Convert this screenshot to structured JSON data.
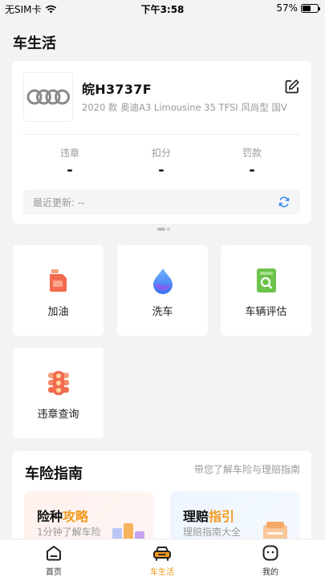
{
  "status_bar": {
    "carrier": "无SIM卡",
    "time": "下午3:58",
    "battery": "57%",
    "battery_level": 0.57
  },
  "page_title": "车生活",
  "car": {
    "plate": "皖H3737F",
    "model": "2020 款 奥迪A3 Limousine 35 TFSI 风尚型 国V",
    "logo_icon": "audi-rings-icon",
    "stats": [
      {
        "label": "违章",
        "value": "-"
      },
      {
        "label": "扣分",
        "value": "-"
      },
      {
        "label": "罚款",
        "value": "-"
      }
    ],
    "last_update": "最近更新: --"
  },
  "services": [
    {
      "label": "加油",
      "icon": "fuel-can-icon"
    },
    {
      "label": "洗车",
      "icon": "water-drop-icon"
    },
    {
      "label": "车辆评估",
      "icon": "evaluation-icon"
    },
    {
      "label": "违章查询",
      "icon": "traffic-light-icon"
    }
  ],
  "insurance_guide": {
    "title": "车险指南",
    "subtitle": "带您了解车险与理赔指南",
    "cards": [
      {
        "title_a": "险种",
        "title_b": "攻略",
        "desc": "1分钟了解车险"
      },
      {
        "title_a": "理赔",
        "title_b": "指引",
        "desc": "理赔指南大全"
      }
    ]
  },
  "tabbar": [
    {
      "label": "首页",
      "icon": "home-icon",
      "active": false
    },
    {
      "label": "车生活",
      "icon": "car-icon",
      "active": true
    },
    {
      "label": "我的",
      "icon": "profile-icon",
      "active": false
    }
  ],
  "colors": {
    "accent": "#f39a1b",
    "refresh": "#3a8cf0"
  }
}
